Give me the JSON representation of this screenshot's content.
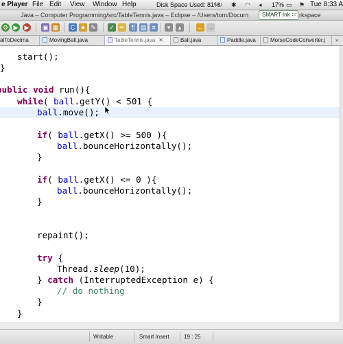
{
  "menubar": {
    "app_name": "e Player",
    "items": [
      "File",
      "Edit",
      "View",
      "Window",
      "Help"
    ],
    "disk_space": "Disk Space Used: 81%",
    "battery": "17%",
    "clock": "Tue 8:33 AM"
  },
  "window": {
    "title": "Java – Computer Programming/src/TableTennis.java – Eclipse – /Users/tom/Docum",
    "title_tail": "rkspace",
    "smart_ink": "SMART Ink"
  },
  "tabs": [
    {
      "label": "alToDecima",
      "active": false
    },
    {
      "label": "MovingBall.java",
      "active": false
    },
    {
      "label": "TableTennis.java",
      "active": true
    },
    {
      "label": "Ball.java",
      "active": false
    },
    {
      "label": "Paddle.java",
      "active": false
    },
    {
      "label": "MorseCodeConverter.j",
      "active": false
    }
  ],
  "code": {
    "l1": "start();",
    "l2": "}",
    "l3_kw1": "public",
    "l3_kw2": "void",
    "l3_rest": " run(){",
    "l4_kw": "while",
    "l4_a": "( ",
    "l4_fld": "ball",
    "l4_b": ".getY() < 501 ",
    "l4_brace": "{",
    "l5_fld": "ball",
    "l5_rest": ".move();",
    "l6_kw": "if",
    "l6_a": "( ",
    "l6_fld": "ball",
    "l6_b": ".getX() >= 500 ){",
    "l7_fld": "ball",
    "l7_rest": ".bounceHorizontally();",
    "l8": "}",
    "l9_kw": "if",
    "l9_a": "( ",
    "l9_fld": "ball",
    "l9_b": ".getX() <= 0 ){",
    "l10_fld": "ball",
    "l10_rest": ".bounceHorizontally();",
    "l11": "}",
    "l12": "repaint();",
    "l13_kw": "try",
    "l13_rest": " {",
    "l14_a": "Thread.",
    "l14_st": "sleep",
    "l14_b": "(10);",
    "l15_a": "} ",
    "l15_kw": "catch",
    "l15_b": " (InterruptedException e) {",
    "l16": "// do nothing",
    "l17": "}",
    "l18": "}"
  },
  "status": {
    "mode": "Writable",
    "insert": "Smart Insert",
    "position": "19 : 25"
  },
  "colors": {
    "keyword": "#7f0055",
    "field": "#0000c0",
    "comment": "#3f7f5f",
    "current_line": "#e8f2fe"
  }
}
